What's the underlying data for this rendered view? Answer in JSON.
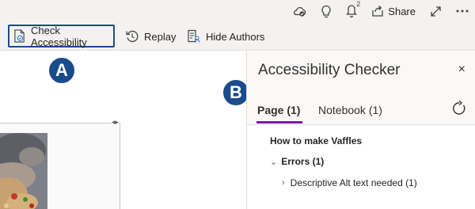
{
  "topbar": {
    "notification_count": "2",
    "share_label": "Share",
    "icons": [
      "cloud-check-icon",
      "lightbulb-icon",
      "share-icon",
      "expand-icon",
      "more-icon"
    ]
  },
  "ribbon": {
    "check_accessibility_label": "Check Accessibility",
    "replay_label": "Replay",
    "hide_authors_label": "Hide Authors"
  },
  "callouts": {
    "a": "A",
    "b": "B"
  },
  "pane": {
    "title": "Accessibility Checker",
    "close_glyph": "×",
    "tabs": [
      {
        "label": "Page (1)",
        "selected": true
      },
      {
        "label": "Notebook (1)",
        "selected": false
      }
    ],
    "results": {
      "page_name": "How to make Vaffles",
      "errors_label": "Errors (1)",
      "error_item": "Descriptive Alt text needed (1)"
    }
  },
  "colors": {
    "callout": "#1a4b8c",
    "tab_accent": "#7719aa",
    "ribbon_bg": "#f3f2f1"
  }
}
